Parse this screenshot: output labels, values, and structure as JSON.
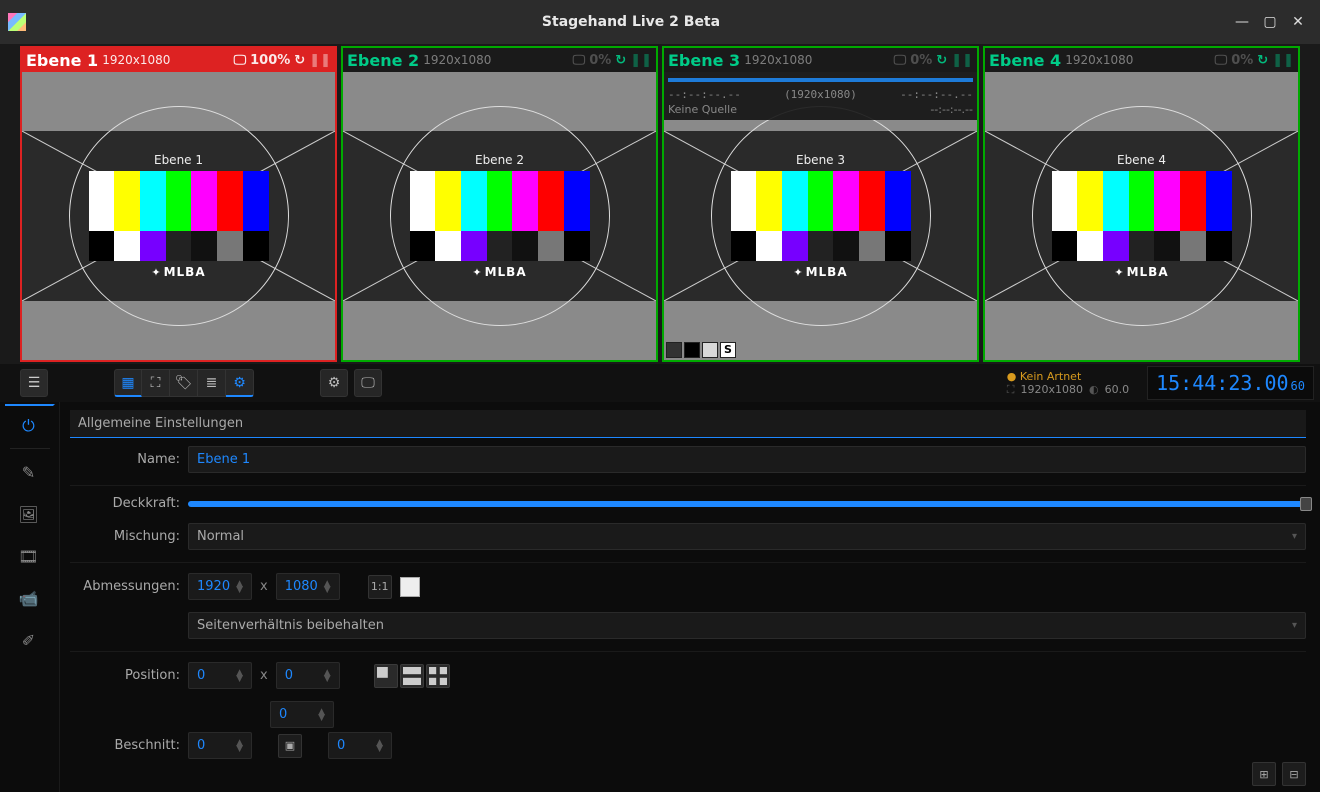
{
  "window": {
    "title": "Stagehand Live 2 Beta"
  },
  "layers": [
    {
      "name": "Ebene 1",
      "resolution": "1920x1080",
      "pct": "100%",
      "active": true
    },
    {
      "name": "Ebene 2",
      "resolution": "1920x1080",
      "pct": "0%",
      "active": false
    },
    {
      "name": "Ebene 3",
      "resolution": "1920x1080",
      "pct": "0%",
      "active": false,
      "source": {
        "tc_left": "--:--:--.--",
        "res": "(1920x1080)",
        "tc_right": "--:--:--.--",
        "no_source": "Keine Quelle",
        "tc_right2": "--:--:--.--"
      },
      "footer_swatches": [
        "#333",
        "#000",
        "#d8d8d8",
        "S"
      ]
    },
    {
      "name": "Ebene 4",
      "resolution": "1920x1080",
      "pct": "0%",
      "active": false
    }
  ],
  "status": {
    "artnet_warning": "Kein Artnet",
    "resolution": "1920x1080",
    "fps": "60.0"
  },
  "clock": {
    "time": "15:44:23.00",
    "frame": "60"
  },
  "form": {
    "section": "Allgemeine Einstellungen",
    "labels": {
      "name": "Name:",
      "opacity": "Deckkraft:",
      "blend": "Mischung:",
      "dims": "Abmessungen:",
      "pos": "Position:",
      "crop": "Beschnitt:"
    },
    "name_value": "Ebene 1",
    "blend_value": "Normal",
    "dim_w": "1920",
    "dim_h": "1080",
    "aspect_btn": "1:1",
    "aspect_mode": "Seitenverhältnis beibehalten",
    "pos_x": "0",
    "pos_y": "0",
    "crop_top": "0",
    "crop_left": "0",
    "crop_right": "0",
    "x_sep": "x",
    "opacity_pct": 100
  }
}
